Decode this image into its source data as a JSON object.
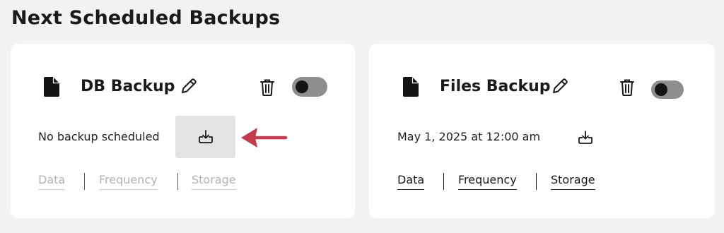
{
  "page": {
    "title": "Next Scheduled Backups"
  },
  "colors": {
    "accent_arrow": "#c23a4c",
    "toggle_track": "#8e8e8e",
    "toggle_knob": "#141414",
    "disabled_text": "#b3b3b3"
  },
  "cards": [
    {
      "title": "DB Backup",
      "schedule_text": "No backup scheduled",
      "toggle_on": false,
      "tabs_enabled": false,
      "tabs": [
        "Data",
        "Frequency",
        "Storage"
      ],
      "icons": [
        "document-icon",
        "pencil-icon",
        "trash-icon",
        "download-icon"
      ]
    },
    {
      "title": "Files Backup",
      "schedule_text": "May 1, 2025 at 12:00 am",
      "toggle_on": false,
      "tabs_enabled": true,
      "tabs": [
        "Data",
        "Frequency",
        "Storage"
      ],
      "icons": [
        "document-icon",
        "pencil-icon",
        "trash-icon",
        "download-icon"
      ]
    }
  ]
}
